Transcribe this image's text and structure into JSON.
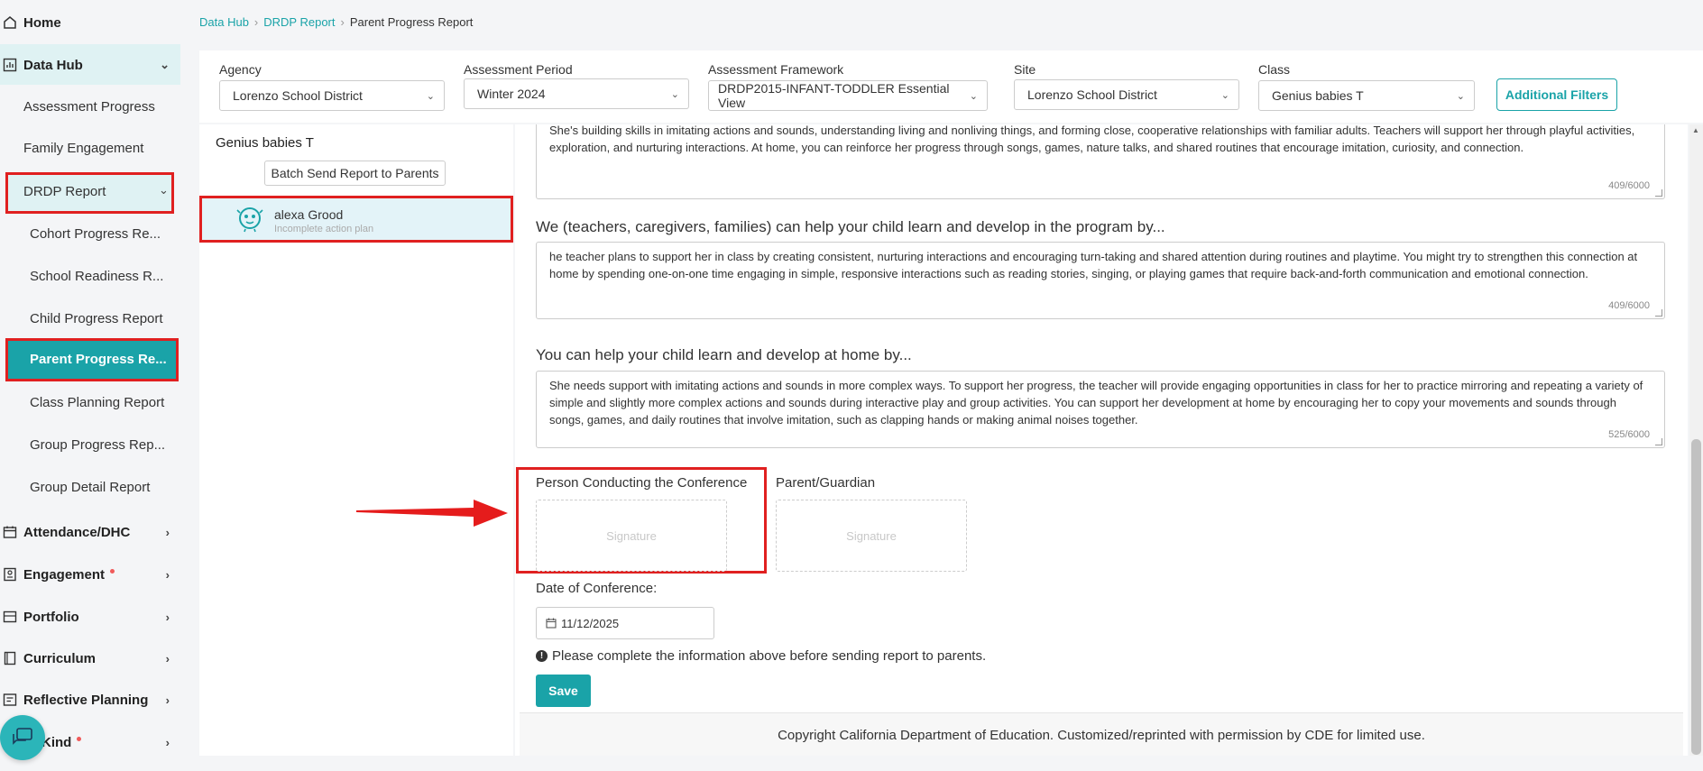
{
  "sidebar": {
    "home": "Home",
    "data_hub": "Data Hub",
    "sub_items": [
      "Assessment Progress",
      "Family Engagement",
      "DRDP Report"
    ],
    "drdp_items": [
      "Cohort Progress Re...",
      "School Readiness R...",
      "Child Progress Report",
      "Parent Progress Re...",
      "Class Planning Report",
      "Group Progress Rep...",
      "Group Detail Report"
    ],
    "attendance": "Attendance/DHC",
    "engagement": "Engagement",
    "portfolio": "Portfolio",
    "curriculum": "Curriculum",
    "reflective": "Reflective Planning",
    "kind": "Kind"
  },
  "breadcrumb": {
    "item1": "Data Hub",
    "item2": "DRDP Report",
    "current": "Parent Progress Report"
  },
  "filters": {
    "agency_label": "Agency",
    "agency_value": "Lorenzo School District",
    "period_label": "Assessment Period",
    "period_value": "Winter 2024",
    "framework_label": "Assessment Framework",
    "framework_value": "DRDP2015-INFANT-TODDLER Essential View",
    "site_label": "Site",
    "site_value": "Lorenzo School District",
    "class_label": "Class",
    "class_value": "Genius babies T",
    "additional_filters": "Additional Filters"
  },
  "left_panel": {
    "class_title": "Genius babies T",
    "batch_send": "Batch Send Report to Parents",
    "student_name": "alexa Grood",
    "student_status": "Incomplete action plan"
  },
  "main": {
    "text1": "She's building skills in imitating actions and sounds, understanding living and nonliving things, and forming close, cooperative relationships with familiar adults. Teachers will support her through playful activities, exploration, and nurturing interactions. At home, you can reinforce her progress through songs, games, nature talks, and shared routines that encourage imitation, curiosity, and connection.",
    "count1": "409/6000",
    "q2": "We (teachers, caregivers, families) can help your child learn and develop in the program by...",
    "text2": "he teacher plans to support her in class by creating consistent, nurturing interactions and encouraging turn-taking and shared attention during routines and playtime. You might try to strengthen this connection at home by spending one-on-one time engaging in simple, responsive interactions such as reading stories, singing, or playing games that require back-and-forth communication and emotional connection.",
    "count2": "409/6000",
    "q3": "You can help your child learn and develop at home by...",
    "text3": "She needs support with imitating actions and sounds in more complex ways. To support her progress, the teacher will provide engaging opportunities in class for her to practice mirroring and repeating a variety of simple and slightly more complex actions and sounds during interactive play and group activities. You can support her development at home by encouraging her to copy your movements and sounds through songs, games, and daily routines that involve imitation, such as clapping hands or making animal noises together.",
    "count3": "525/6000",
    "sig1_label": "Person Conducting the Conference",
    "sig2_label": "Parent/Guardian",
    "sig_placeholder": "Signature",
    "date_label": "Date of Conference:",
    "date_value": "11/12/2025",
    "warning": "Please complete the information above before sending report to parents.",
    "save": "Save",
    "footer": "Copyright California Department of Education. Customized/reprinted with permission by CDE for limited use."
  },
  "colors": {
    "accent": "#1aa3a8",
    "highlight_red": "#e02020"
  }
}
